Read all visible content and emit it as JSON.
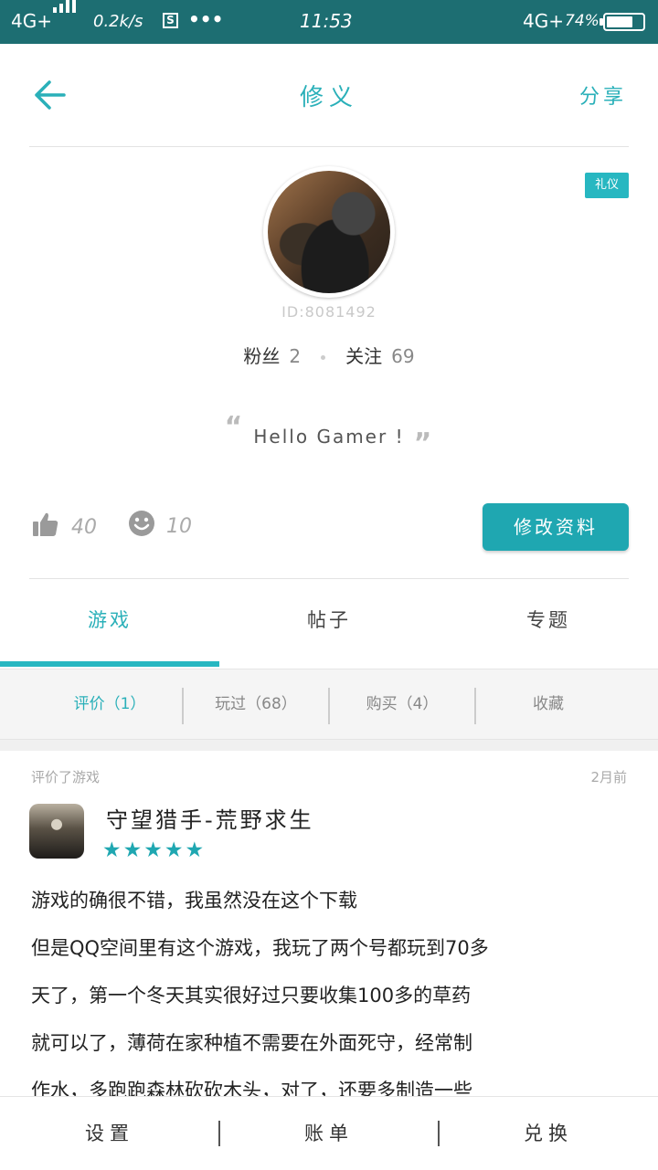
{
  "status_bar": {
    "network_left": "4G+",
    "speed": "0.2k/s",
    "app_badge": "S",
    "more": "•••",
    "time": "11:53",
    "network_right": "4G+",
    "battery_percent": "74%",
    "battery_level": 0.74
  },
  "header": {
    "title": "修义",
    "share_label": "分享"
  },
  "profile": {
    "badge": "礼仪",
    "id_text": "ID:8081492",
    "fans_label": "粉丝",
    "fans_count": "2",
    "following_label": "关注",
    "following_count": "69",
    "quote": "Hello Gamer !",
    "likes": "40",
    "smiles": "10",
    "edit_button": "修改资料"
  },
  "tabs": [
    {
      "label": "游戏",
      "active": true
    },
    {
      "label": "帖子",
      "active": false
    },
    {
      "label": "专题",
      "active": false
    }
  ],
  "sub_tabs": [
    {
      "label": "评价（1）",
      "active": true
    },
    {
      "label": "玩过（68）",
      "active": false
    },
    {
      "label": "购买（4）",
      "active": false
    },
    {
      "label": "收藏",
      "active": false
    }
  ],
  "review": {
    "meta": "评价了游戏",
    "time": "2月前",
    "game_name": "守望猎手-荒野求生",
    "stars": "★★★★★",
    "rating": 5,
    "lines": [
      "游戏的确很不错，我虽然没在这个下载",
      "但是QQ空间里有这个游戏，我玩了两个号都玩到70多",
      "天了，第一个冬天其实很好过只要收集100多的草药",
      "就可以了，薄荷在家种植不需要在外面死守，经常制",
      "作水，多跑跑森林砍砍木头，对了，还要多制造一些"
    ]
  },
  "bottom_bar": {
    "settings": "设置",
    "bill": "账单",
    "exchange": "兑换"
  },
  "colors": {
    "accent": "#27b7c1",
    "status_bar": "#1d6e72"
  }
}
